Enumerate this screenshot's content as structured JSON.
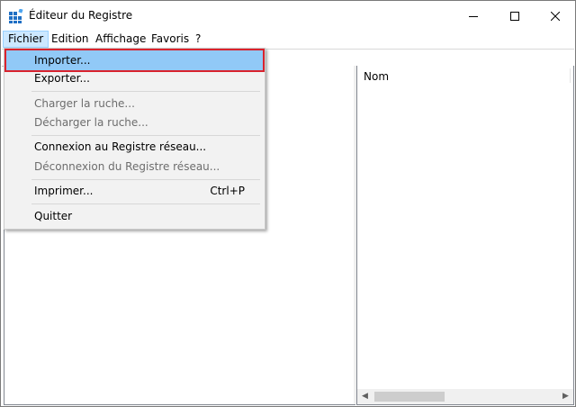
{
  "window": {
    "title": "Éditeur du Registre",
    "icon": "registry-editor-icon"
  },
  "caption_buttons": {
    "minimize": "minimize-icon",
    "maximize": "maximize-icon",
    "close": "close-icon"
  },
  "menubar": {
    "items": [
      {
        "label": "Fichier",
        "active": true
      },
      {
        "label": "Edition"
      },
      {
        "label": "Affichage"
      },
      {
        "label": "Favoris"
      },
      {
        "label": "?"
      }
    ]
  },
  "file_menu": {
    "items": [
      {
        "label": "Importer...",
        "enabled": true,
        "highlighted": true
      },
      {
        "label": "Exporter...",
        "enabled": true
      },
      {
        "label": "Charger la ruche...",
        "enabled": false
      },
      {
        "label": "Décharger la ruche...",
        "enabled": false
      },
      {
        "label": "Connexion au Registre réseau...",
        "enabled": true
      },
      {
        "label": "Déconnexion du Registre réseau...",
        "enabled": false
      },
      {
        "label": "Imprimer...",
        "enabled": true,
        "shortcut": "Ctrl+P"
      },
      {
        "label": "Quitter",
        "enabled": true
      }
    ]
  },
  "list_pane": {
    "columns": [
      {
        "label": "Nom"
      }
    ]
  },
  "colors": {
    "highlight": "#91c9f7",
    "annotation_outline": "#d9232e",
    "menu_background": "#f2f2f2",
    "active_menu": "#cce8ff"
  }
}
